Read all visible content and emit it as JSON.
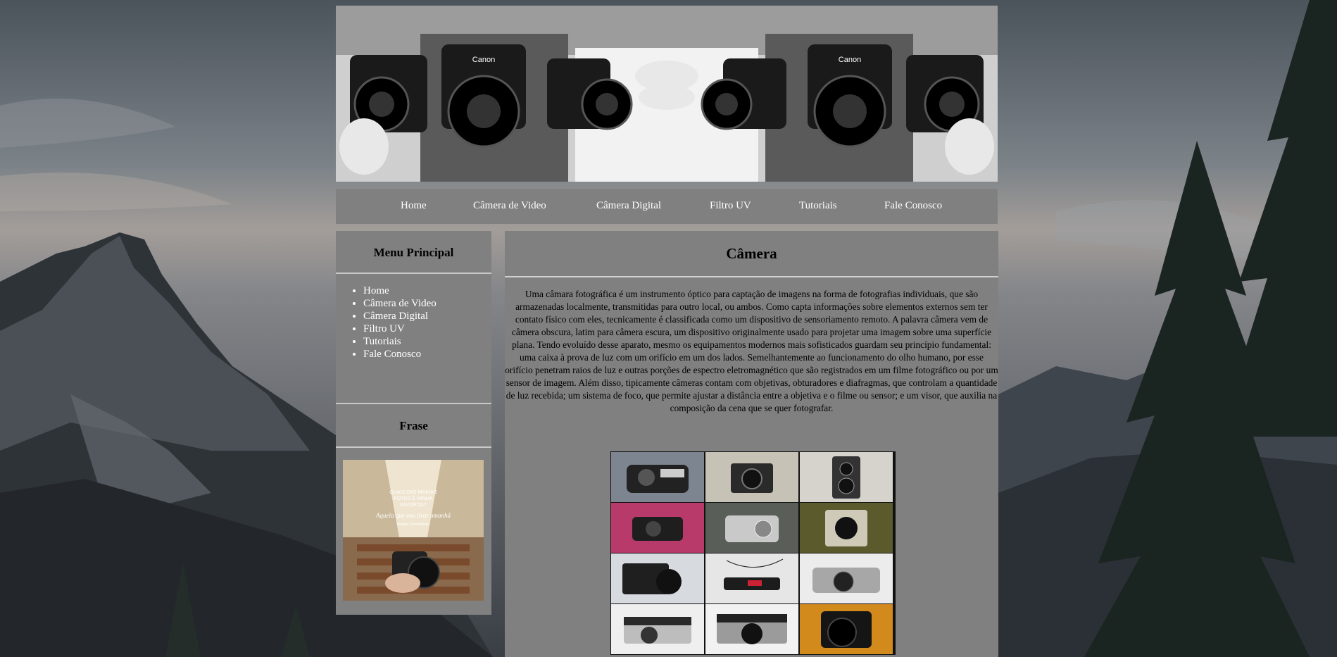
{
  "nav": {
    "items": [
      "Home",
      "Câmera de Video",
      "Câmera Digital",
      "Filtro UV",
      "Tutoriais",
      "Fale Conosco"
    ]
  },
  "sidebar": {
    "menu_title": "Menu Principal",
    "items": [
      "Home",
      "Câmera de Video",
      "Câmera Digital",
      "Filtro UV",
      "Tutoriais",
      "Fale Conosco"
    ],
    "quote_title": "Frase",
    "quote_image": {
      "line1": "QUAIS DAS MINHAS",
      "line2": "FOTOS É MINHA",
      "line3": "FAVORITA?",
      "script": "Aquela que vou tirar amanhã",
      "author": "Imogen Cunningham"
    }
  },
  "main": {
    "title": "Câmera",
    "body": "Uma câmara fotográfica é um instrumento óptico para captação de imagens na forma de fotografias individuais, que são armazenadas localmente, transmitidas para outro local, ou ambos. Como capta informações sobre elementos externos sem ter contato físico com eles, tecnicamente é classificada como um dispositivo de sensoriamento remoto. A palavra câmera vem de câmera obscura, latim para câmera escura, um dispositivo originalmente usado para projetar uma imagem sobre uma superfície plana. Tendo evoluído desse aparato, mesmo os equipamentos modernos mais sofisticados guardam seu princípio fundamental: uma caixa à prova de luz com um orifício em um dos lados. Semelhantemente ao funcionamento do olho humano, por esse orifício penetram raios de luz e outras porções de espectro eletromagnético que são registrados em um filme fotográfico ou por um sensor de imagem. Além disso, tipicamente câmeras contam com objetivas, obturadores e diafragmas, que controlam a quantidade de luz recebida; um sistema de foco, que permite ajustar a distância entre a objetiva e o filme ou sensor; e um visor, que auxilia na composição da cena que se quer fotografar."
  },
  "banner": {
    "brand": "Canon"
  },
  "colors": {
    "panel": "#808080",
    "rule": "#c9c9c9",
    "nav_text": "#ffffff"
  }
}
